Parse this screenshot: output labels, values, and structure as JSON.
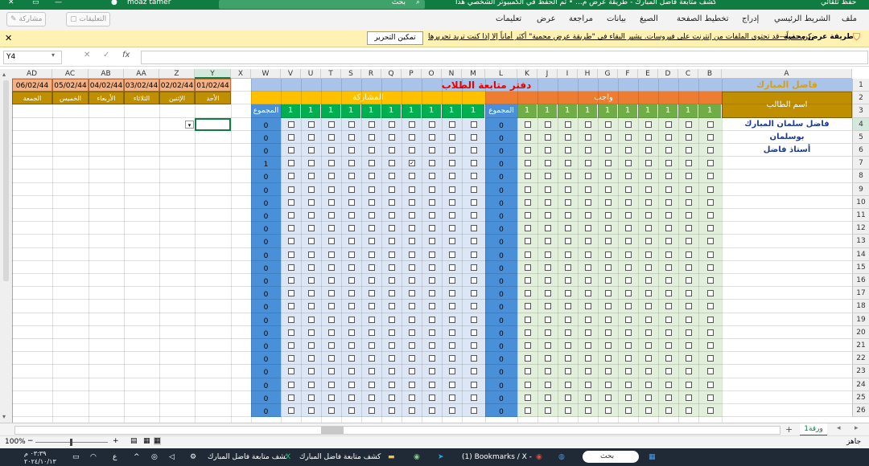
{
  "titlebar": {
    "doc_title": "كشف متابعة فاضل المبارك - طريقة عرض م... • تم الحفظ في الكمبيوتر الشخصي هذا",
    "autosave_label": "حفظ تلقائي",
    "search_placeholder": "بحث",
    "user_name": "moaz tamer",
    "close_glyph": "✕"
  },
  "ribbon": {
    "tabs": [
      "ملف",
      "الشريط الرئيسي",
      "إدراج",
      "تخطيط الصفحة",
      "الصيغ",
      "بيانات",
      "مراجعة",
      "عرض",
      "تعليمات"
    ],
    "share_label": "مشاركة",
    "comments_label": "التعليقات"
  },
  "protected_view": {
    "title": "طريقة عرض محمية",
    "message": "كن حذراً—قد تحتوي الملفات من إنترنت على فيروسات. يشير البقاء في \"طريقة عرض محمية\" أكثر أماناً إلا إذا كنت تريد تحريرها.",
    "enable_label": "تمكين التحرير"
  },
  "formula_bar": {
    "name_box": "Y4",
    "fx_label": "fx",
    "formula_value": ""
  },
  "sheet": {
    "title": "دفتر متابعة الطلاب",
    "logo_text": "فاضل المبارك",
    "homework_label": "واجب",
    "participation_label": "المشاركة",
    "total_label": "المجموع",
    "student_name_label": "اسم الطالب",
    "students": [
      "فاضل سلمان المبارك",
      "بوسلمان",
      "أستاذ فاضل"
    ],
    "participation_totals": [
      "0",
      "0",
      "0",
      "1",
      "0",
      "0",
      "0",
      "0",
      "0",
      "0",
      "0",
      "0",
      "0",
      "0",
      "0",
      "0",
      "0",
      "0",
      "0",
      "0",
      "0",
      "0",
      "0"
    ],
    "homework_totals": [
      "0",
      "0",
      "0",
      "0",
      "0",
      "0",
      "0",
      "0",
      "0",
      "0",
      "0",
      "0",
      "0",
      "0",
      "0",
      "0",
      "0",
      "0",
      "0",
      "0",
      "0",
      "0",
      "0"
    ],
    "column_headers": [
      "AD",
      "AC",
      "AB",
      "AA",
      "Z",
      "Y",
      "X",
      "W",
      "V",
      "U",
      "T",
      "S",
      "R",
      "Q",
      "P",
      "O",
      "N",
      "M",
      "L",
      "K",
      "J",
      "I",
      "H",
      "G",
      "F",
      "E",
      "D",
      "C",
      "B",
      "A"
    ],
    "dates": [
      "06/02/44",
      "05/02/44",
      "04/02/44",
      "03/02/44",
      "02/02/44",
      "01/02/44"
    ],
    "days": [
      "الجمعة",
      "الخميس",
      "الأربعاء",
      "الثلاثاء",
      "الإثنين",
      "الأحد"
    ],
    "weight_value": "1",
    "row_numbers": [
      "1",
      "2",
      "3",
      "4",
      "5",
      "6",
      "7",
      "8",
      "9",
      "10",
      "11",
      "12",
      "13",
      "14",
      "15",
      "16",
      "17",
      "18",
      "19",
      "20",
      "21",
      "22",
      "23",
      "24",
      "25",
      "26"
    ],
    "checked_cell": "P7"
  },
  "sheet_tabs": {
    "active_tab": "ورقة1",
    "add_glyph": "+"
  },
  "status": {
    "ready": "جاهز",
    "zoom": "100%"
  },
  "taskbar": {
    "time": "٠٣:٣٩ م",
    "date": "٢٠٢٤/١٠/١٣",
    "lang": "ع",
    "excel_task": "كشف متابعة فاضل المبارك",
    "excel_task2": "كشف متابعة فاضل المبارك",
    "browser_task": "(1) Bookmarks / X - Go...",
    "search_placeholder": "بحث"
  },
  "colors": {
    "excel_green": "#107c41",
    "title_blue": "#a9c4e8",
    "homework_orange": "#ed7d31",
    "participation_yellow": "#ffc000",
    "header_gold": "#bf8f00",
    "green_header": "#70ad47",
    "participation_green": "#00b050",
    "totals_blue": "#4a90d9",
    "homework_fill": "#e2efda",
    "participation_fill": "#dce6f5",
    "date_orange": "#f4b183"
  }
}
